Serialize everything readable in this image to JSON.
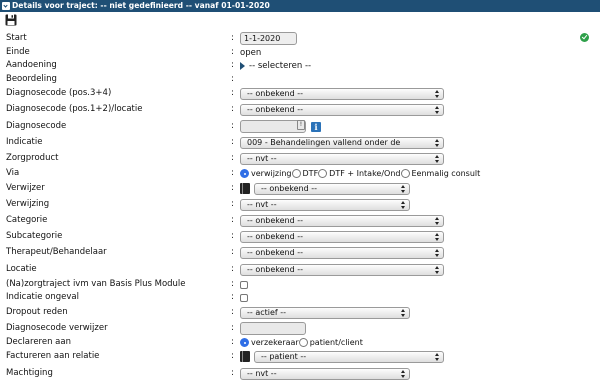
{
  "header": {
    "title": "Details voor traject: -- niet gedefinieerd -- vanaf 01-01-2020"
  },
  "fields": {
    "start": {
      "label": "Start",
      "value": "1-1-2020"
    },
    "einde": {
      "label": "Einde",
      "value": "open"
    },
    "aandoening": {
      "label": "Aandoening",
      "value": "-- selecteren --"
    },
    "beoordeling": {
      "label": "Beoordeling"
    },
    "diag34": {
      "label": "Diagnosecode (pos.3+4)",
      "value": "-- onbekend --"
    },
    "diag12": {
      "label": "Diagnosecode (pos.1+2)/locatie",
      "value": "-- onbekend --"
    },
    "diagnosecode": {
      "label": "Diagnosecode",
      "value": ""
    },
    "indicatie": {
      "label": "Indicatie",
      "value": "009 - Behandelingen vallend onder de"
    },
    "zorgproduct": {
      "label": "Zorgproduct",
      "value": "-- nvt --"
    },
    "via": {
      "label": "Via",
      "options": [
        "verwijzing",
        "DTF",
        "DTF + Intake/Ond",
        "Eenmalig consult"
      ],
      "selected": "verwijzing"
    },
    "verwijzer": {
      "label": "Verwijzer",
      "value": "-- onbekend --"
    },
    "verwijzing": {
      "label": "Verwijzing",
      "value": "-- nvt --"
    },
    "categorie": {
      "label": "Categorie",
      "value": "-- onbekend --"
    },
    "subcategorie": {
      "label": "Subcategorie",
      "value": "-- onbekend --"
    },
    "therapeut": {
      "label": "Therapeut/Behandelaar",
      "value": "-- onbekend --"
    },
    "locatie": {
      "label": "Locatie",
      "value": "-- onbekend --"
    },
    "nazorg": {
      "label": "(Na)zorgtraject ivm van Basis Plus Module",
      "checked": false
    },
    "indicatie_ongeval": {
      "label": "Indicatie ongeval",
      "checked": false
    },
    "dropout": {
      "label": "Dropout reden",
      "value": "-- actief --"
    },
    "diag_verwijzer": {
      "label": "Diagnosecode verwijzer",
      "value": ""
    },
    "declareren": {
      "label": "Declareren aan",
      "options": [
        "verzekeraar",
        "patient/client"
      ],
      "selected": "verzekeraar"
    },
    "factureren": {
      "label": "Factureren aan relatie",
      "value": "-- patient --"
    },
    "machtiging": {
      "label": "Machtiging",
      "value": "-- nvt --"
    }
  },
  "icons": {
    "save": "save-icon",
    "ok": "checkmark-circle-icon",
    "info": "info-icon",
    "book": "address-book-icon"
  },
  "colors": {
    "header_bg": "#1f4f75",
    "accent": "#2f6ee6",
    "ok": "#2ea04a"
  }
}
